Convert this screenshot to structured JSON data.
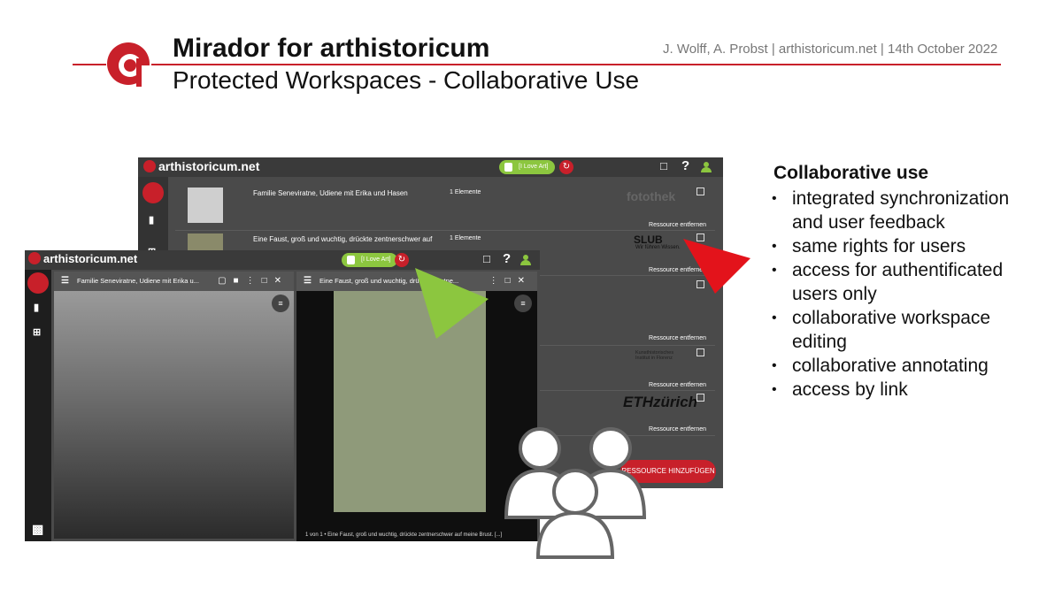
{
  "slide": {
    "title": "Mirador for arthistoricum",
    "subtitle": "Protected Workspaces - Collaborative Use",
    "author_line": "J. Wolff, A. Probst | arthistoricum.net | 14th October 2022",
    "accent_color": "#c8202a"
  },
  "feature_list": {
    "heading": "Collaborative use",
    "items": [
      "integrated synchronization and user feedback",
      "same rights for users",
      "access for authentificated users only",
      "collaborative workspace editing",
      "collaborative annotating",
      "access by link"
    ]
  },
  "back_window": {
    "brand": "arthistoricum.net",
    "workspace_label": "I Love Art",
    "resources": [
      {
        "title": "Familie Seneviratne, Udiene mit Erika und Hasen",
        "count": "1 Elemente",
        "logo": "fotothek",
        "remove": "Ressource entfernen"
      },
      {
        "title": "Eine Faust, groß und wuchtig, drückte zentnerschwer auf",
        "count": "1 Elemente",
        "logo": "SLUB",
        "remove": "Ressource entfernen"
      },
      {
        "title": "",
        "count": "",
        "logo": "",
        "remove": "Ressource entfernen"
      },
      {
        "title": "",
        "count": "",
        "logo": "Kunsthistorisches Institut in Florenz",
        "remove": "Ressource entfernen"
      },
      {
        "title": "",
        "count": "",
        "logo": "ETHzürich",
        "remove": "Ressource entfernen"
      }
    ],
    "logo_slub_sub": "Wir führen Wissen.",
    "add_button": "RESSOURCE HINZUFÜGEN"
  },
  "front_window": {
    "brand": "arthistoricum.net",
    "workspace_label": "I Love Art",
    "panes": [
      {
        "title": "Familie Seneviratne, Udiene mit Erika u..."
      },
      {
        "title": "Eine Faust, groß und wuchtig, drückte zentne..."
      }
    ],
    "caption": "1 von 1 • Eine Faust, groß und wuchtig, drückte zentnerschwer auf meine Brust. [...]"
  },
  "icons": [
    "logo-a-icon",
    "lock-icon",
    "sync-icon",
    "clipboard-icon",
    "help-icon",
    "user-icon",
    "menu-icon",
    "window-icon",
    "grid-icon",
    "close-icon",
    "expand-icon",
    "more-icon",
    "tuner-icon",
    "users-group-icon",
    "arrow-icon"
  ]
}
